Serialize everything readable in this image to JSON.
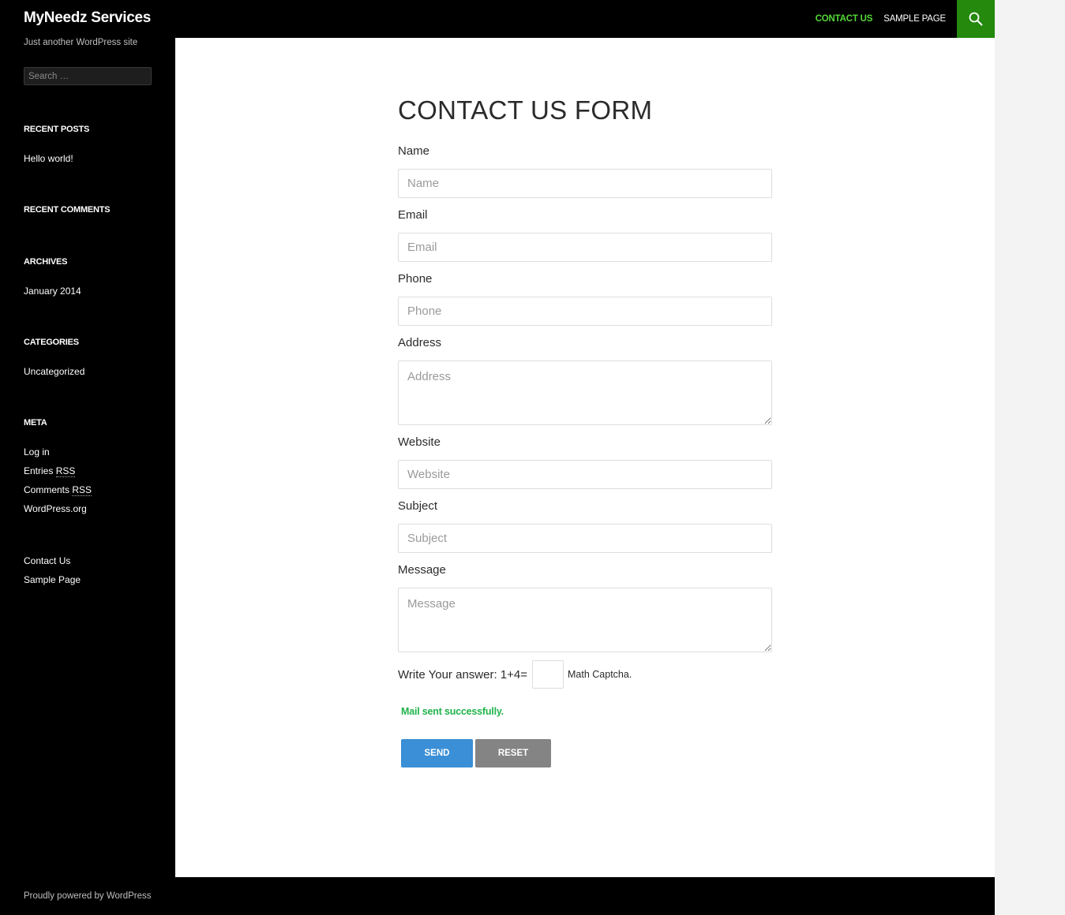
{
  "header": {
    "site_title": "MyNeedz Services",
    "nav": [
      {
        "label": "CONTACT US",
        "active": true
      },
      {
        "label": "SAMPLE PAGE",
        "active": false
      }
    ],
    "search_icon": "search-icon"
  },
  "sidebar": {
    "tagline": "Just another WordPress site",
    "search_placeholder": "Search …",
    "widgets": {
      "recent_posts": {
        "title": "RECENT POSTS",
        "items": [
          "Hello world!"
        ]
      },
      "recent_comments": {
        "title": "RECENT COMMENTS"
      },
      "archives": {
        "title": "ARCHIVES",
        "items": [
          "January 2014"
        ]
      },
      "categories": {
        "title": "CATEGORIES",
        "items": [
          "Uncategorized"
        ]
      },
      "meta": {
        "title": "META",
        "items": [
          "Log in",
          "Entries",
          "Comments",
          "WordPress.org"
        ],
        "rss": "RSS"
      },
      "pages": {
        "items": [
          "Contact Us",
          "Sample Page"
        ]
      }
    }
  },
  "form": {
    "title": "CONTACT US FORM",
    "fields": [
      {
        "label": "Name",
        "placeholder": "Name"
      },
      {
        "label": "Email",
        "placeholder": "Email"
      },
      {
        "label": "Phone",
        "placeholder": "Phone"
      },
      {
        "label": "Address",
        "placeholder": "Address"
      },
      {
        "label": "Website",
        "placeholder": "Website"
      },
      {
        "label": "Subject",
        "placeholder": "Subject"
      },
      {
        "label": "Message",
        "placeholder": "Message"
      }
    ],
    "captcha_question": "Write Your answer: 1+4=",
    "captcha_value": "",
    "captcha_hint": "Math Captcha.",
    "success_message": "Mail sent successfully.",
    "send_label": "SEND",
    "reset_label": "RESET"
  },
  "footer": {
    "credit": "Proudly powered by WordPress"
  },
  "colors": {
    "accent_green": "#24890d",
    "nav_active": "#55d737",
    "success": "#1fb34b",
    "send_button": "#3a8fd6",
    "reset_button": "#848484"
  }
}
